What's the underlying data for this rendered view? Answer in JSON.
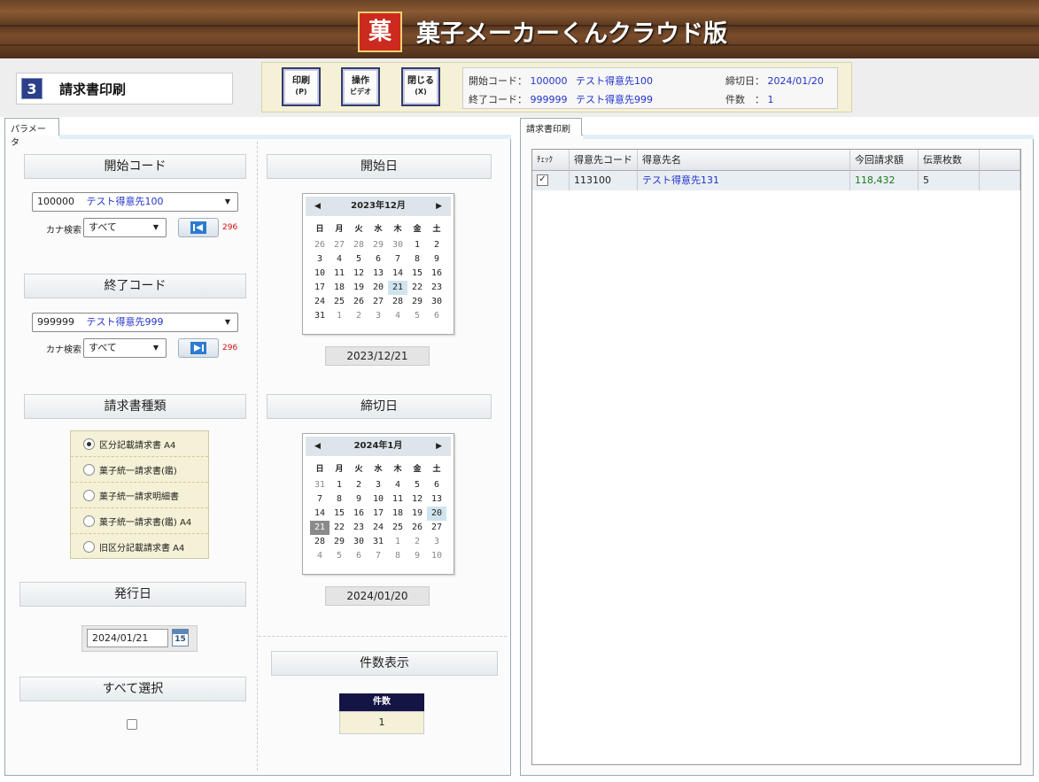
{
  "header": {
    "logo_text": "菓",
    "app_title": "菓子メーカーくんクラウド版"
  },
  "screen": {
    "number": "3",
    "title": "請求書印刷"
  },
  "toolbar": {
    "print": {
      "label": "印刷",
      "key": "(P)"
    },
    "video": {
      "label": "操作",
      "sub": "ビデオ"
    },
    "close": {
      "label": "閉じる",
      "key": "(X)"
    }
  },
  "info": {
    "start_code_label": "開始コード：",
    "start_code": "100000",
    "start_name": "テスト得意先100",
    "end_code_label": "終了コード：",
    "end_code": "999999",
    "end_name": "テスト得意先999",
    "cutoff_label": "締切日：",
    "cutoff_value": "2024/01/20",
    "count_label": "件数　：",
    "count_value": "1"
  },
  "tabs": {
    "left": "パラメータ",
    "right": "請求書印刷"
  },
  "params": {
    "start_code_head": "開始コード",
    "start_combo": {
      "code": "100000",
      "name": "テスト得意先100"
    },
    "kana_label": "カナ検索",
    "kana_value": "すべて",
    "start_count": "296",
    "end_code_head": "終了コード",
    "end_combo": {
      "code": "999999",
      "name": "テスト得意先999"
    },
    "end_count": "296",
    "invoice_type_head": "請求書種類",
    "invoice_types": [
      {
        "label": "区分記載請求書 A4",
        "selected": true
      },
      {
        "label": "菓子統一請求書(鑑)",
        "selected": false
      },
      {
        "label": "菓子統一請求明細書",
        "selected": false
      },
      {
        "label": "菓子統一請求書(鑑) A4",
        "selected": false
      },
      {
        "label": "旧区分記載請求書 A4",
        "selected": false
      }
    ],
    "issue_date_head": "発行日",
    "issue_date": "2024/01/21",
    "cal_icon_text": "15",
    "select_all_head": "すべて選択",
    "start_date_head": "開始日",
    "cutoff_head": "締切日",
    "count_head": "件数表示",
    "count_col": "件数",
    "count_value": "1"
  },
  "calendar_start": {
    "month": "2023年12月",
    "weekdays": [
      "日",
      "月",
      "火",
      "水",
      "木",
      "金",
      "土"
    ],
    "weeks": [
      [
        "26",
        "27",
        "28",
        "29",
        "30",
        "1",
        "2"
      ],
      [
        "3",
        "4",
        "5",
        "6",
        "7",
        "8",
        "9"
      ],
      [
        "10",
        "11",
        "12",
        "13",
        "14",
        "15",
        "16"
      ],
      [
        "17",
        "18",
        "19",
        "20",
        "21",
        "22",
        "23"
      ],
      [
        "24",
        "25",
        "26",
        "27",
        "28",
        "29",
        "30"
      ],
      [
        "31",
        "1",
        "2",
        "3",
        "4",
        "5",
        "6"
      ]
    ],
    "value": "2023/12/21"
  },
  "calendar_cutoff": {
    "month": "2024年1月",
    "weekdays": [
      "日",
      "月",
      "火",
      "水",
      "木",
      "金",
      "土"
    ],
    "weeks": [
      [
        "31",
        "1",
        "2",
        "3",
        "4",
        "5",
        "6"
      ],
      [
        "7",
        "8",
        "9",
        "10",
        "11",
        "12",
        "13"
      ],
      [
        "14",
        "15",
        "16",
        "17",
        "18",
        "19",
        "20"
      ],
      [
        "21",
        "22",
        "23",
        "24",
        "25",
        "26",
        "27"
      ],
      [
        "28",
        "29",
        "30",
        "31",
        "1",
        "2",
        "3"
      ],
      [
        "4",
        "5",
        "6",
        "7",
        "8",
        "9",
        "10"
      ]
    ],
    "value": "2024/01/20"
  },
  "grid": {
    "columns": [
      "ﾁｪｯｸ",
      "得意先コード",
      "得意先名",
      "今回請求額",
      "伝票枚数"
    ],
    "rows": [
      {
        "checked": true,
        "check_mark": "✓",
        "code": "113100",
        "name": "テスト得意先131",
        "amount": "118,432",
        "slips": "5"
      }
    ]
  }
}
